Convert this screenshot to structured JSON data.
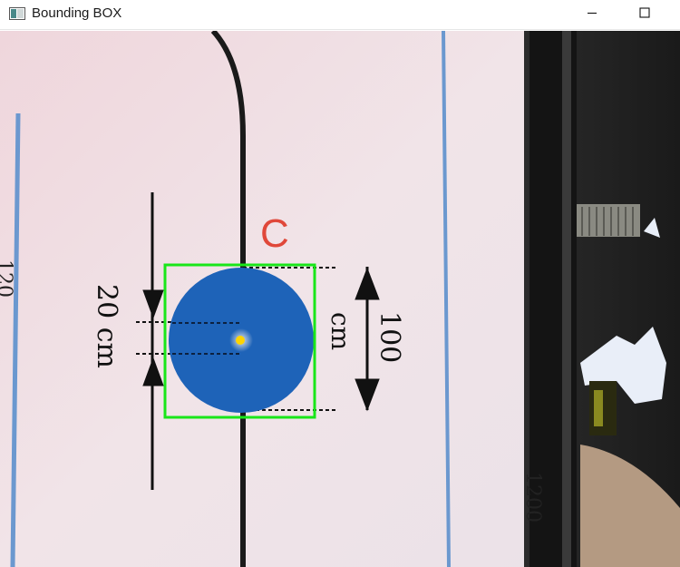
{
  "window": {
    "title": "Bounding BOX",
    "app_icon": "window-app-icon",
    "controls": [
      "minimize-icon",
      "maximize-icon"
    ]
  },
  "frame": {
    "section_letter": "C",
    "dimension_height": "100",
    "dimension_height_unit": "cm",
    "dimension_gap": "20 cm",
    "edge_text_left": "120",
    "edge_text_right": "1200"
  },
  "overlay": {
    "box_color": "#19e619",
    "center_marker_color": "#ffd400",
    "target_color": "#1e63b8"
  }
}
